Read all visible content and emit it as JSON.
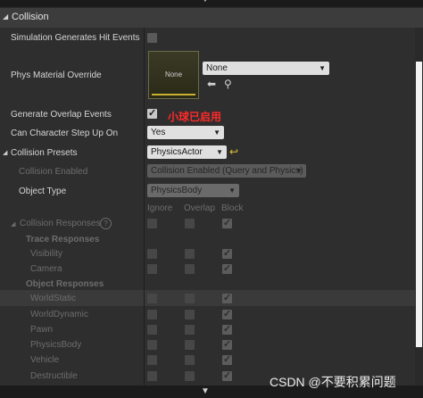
{
  "section": {
    "title": "Collision"
  },
  "simulation_hit_events": {
    "label": "Simulation Generates Hit Events",
    "checked": false
  },
  "phys_material": {
    "label": "Phys Material Override",
    "thumbnail_text": "None",
    "selected": "None"
  },
  "overlap_events": {
    "label": "Generate Overlap Events",
    "checked": true,
    "annotation": "小球已启用"
  },
  "step_up": {
    "label": "Can Character Step Up On",
    "selected": "Yes"
  },
  "presets": {
    "label": "Collision Presets",
    "selected": "PhysicsActor"
  },
  "collision_enabled": {
    "label": "Collision Enabled",
    "selected": "Collision Enabled (Query and Physics)"
  },
  "object_type": {
    "label": "Object Type",
    "selected": "PhysicsBody"
  },
  "columns": {
    "ignore": "Ignore",
    "overlap": "Overlap",
    "block": "Block"
  },
  "responses": {
    "label": "Collision Responses",
    "trace_label": "Trace Responses",
    "object_label": "Object Responses",
    "trace": [
      {
        "name": "Visibility",
        "block": true
      },
      {
        "name": "Camera",
        "block": true
      }
    ],
    "object": [
      {
        "name": "WorldStatic",
        "block": true
      },
      {
        "name": "WorldDynamic",
        "block": true
      },
      {
        "name": "Pawn",
        "block": true
      },
      {
        "name": "PhysicsBody",
        "block": true
      },
      {
        "name": "Vehicle",
        "block": true
      },
      {
        "name": "Destructible",
        "block": true
      }
    ]
  },
  "watermark": "CSDN @不要积累问题",
  "colors": {
    "annotation": "#ff2a2a",
    "panel": "#2e2e2e",
    "header": "#3c3c3c"
  }
}
